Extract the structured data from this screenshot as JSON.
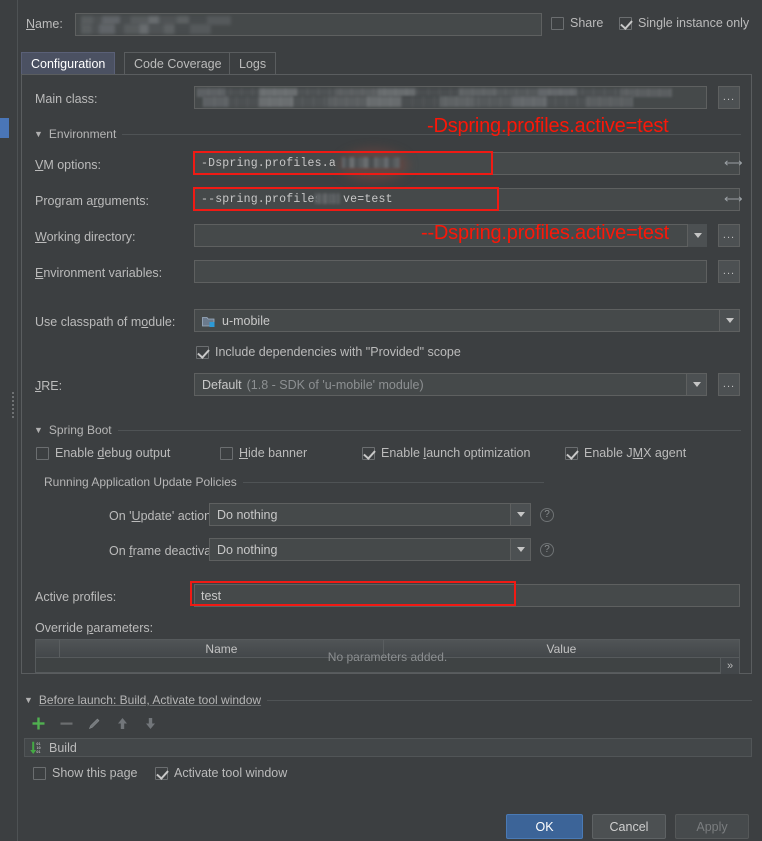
{
  "header": {
    "name_label": "Name:",
    "name_value": "",
    "share_label": "Share",
    "single_instance_label": "Single instance only"
  },
  "tabs": [
    {
      "label": "Configuration",
      "active": true
    },
    {
      "label": "Code Coverage",
      "active": false
    },
    {
      "label": "Logs",
      "active": false
    }
  ],
  "configuration": {
    "main_class_label": "Main class:",
    "main_class_value": "",
    "browse_label": "...",
    "environment_section": "Environment",
    "vm_options_label": "VM options:",
    "vm_options_value": "-Dspring.profiles.a",
    "program_arguments_label": "Program arguments:",
    "program_arguments_value": "--spring.profiles.a       ve=test",
    "working_directory_label": "Working directory:",
    "working_directory_value": "",
    "environment_variables_label": "Environment variables:",
    "environment_variables_value": "",
    "use_classpath_label": "Use classpath of module:",
    "use_classpath_value": "u-mobile",
    "include_provided_label": "Include dependencies with \"Provided\" scope",
    "jre_label": "JRE:",
    "jre_value": "Default",
    "jre_value_detail": "(1.8 - SDK of 'u-mobile' module)"
  },
  "spring_boot": {
    "section_title": "Spring Boot",
    "enable_debug_output": "Enable debug output",
    "hide_banner": "Hide banner",
    "enable_launch_optimization": "Enable launch optimization",
    "enable_jmx_agent": "Enable JMX agent",
    "update_policies_title": "Running Application Update Policies",
    "on_update_label": "On 'Update' action:",
    "on_update_value": "Do nothing",
    "on_frame_deactivation_label": "On frame deactivation:",
    "on_frame_deactivation_value": "Do nothing",
    "help_glyph": "?",
    "active_profiles_label": "Active profiles:",
    "active_profiles_value": "test",
    "override_parameters_label": "Override parameters:",
    "table_headers": [
      "",
      "Name",
      "Value"
    ],
    "table_empty_text": "No parameters added.",
    "table_expand_glyph": "»"
  },
  "before_launch": {
    "section_title": "Before launch: Build, Activate tool window",
    "toolbar": [
      "add-icon",
      "remove-icon",
      "edit-icon",
      "move-up-icon",
      "move-down-icon"
    ],
    "items": [
      {
        "label": "Build",
        "icon": "compile-icon"
      }
    ],
    "show_this_page": "Show this page",
    "activate_tool_window": "Activate tool window"
  },
  "footer": {
    "ok": "OK",
    "cancel": "Cancel",
    "apply": "Apply"
  },
  "annotations": [
    {
      "text": "-Dspring.profiles.active=test"
    },
    {
      "text": "--Dspring.profiles.active=test"
    }
  ],
  "colors": {
    "accent": "#4a88c7",
    "annotation": "#fb1708",
    "primary_button": "#3c6498",
    "background": "#3c3f41"
  }
}
